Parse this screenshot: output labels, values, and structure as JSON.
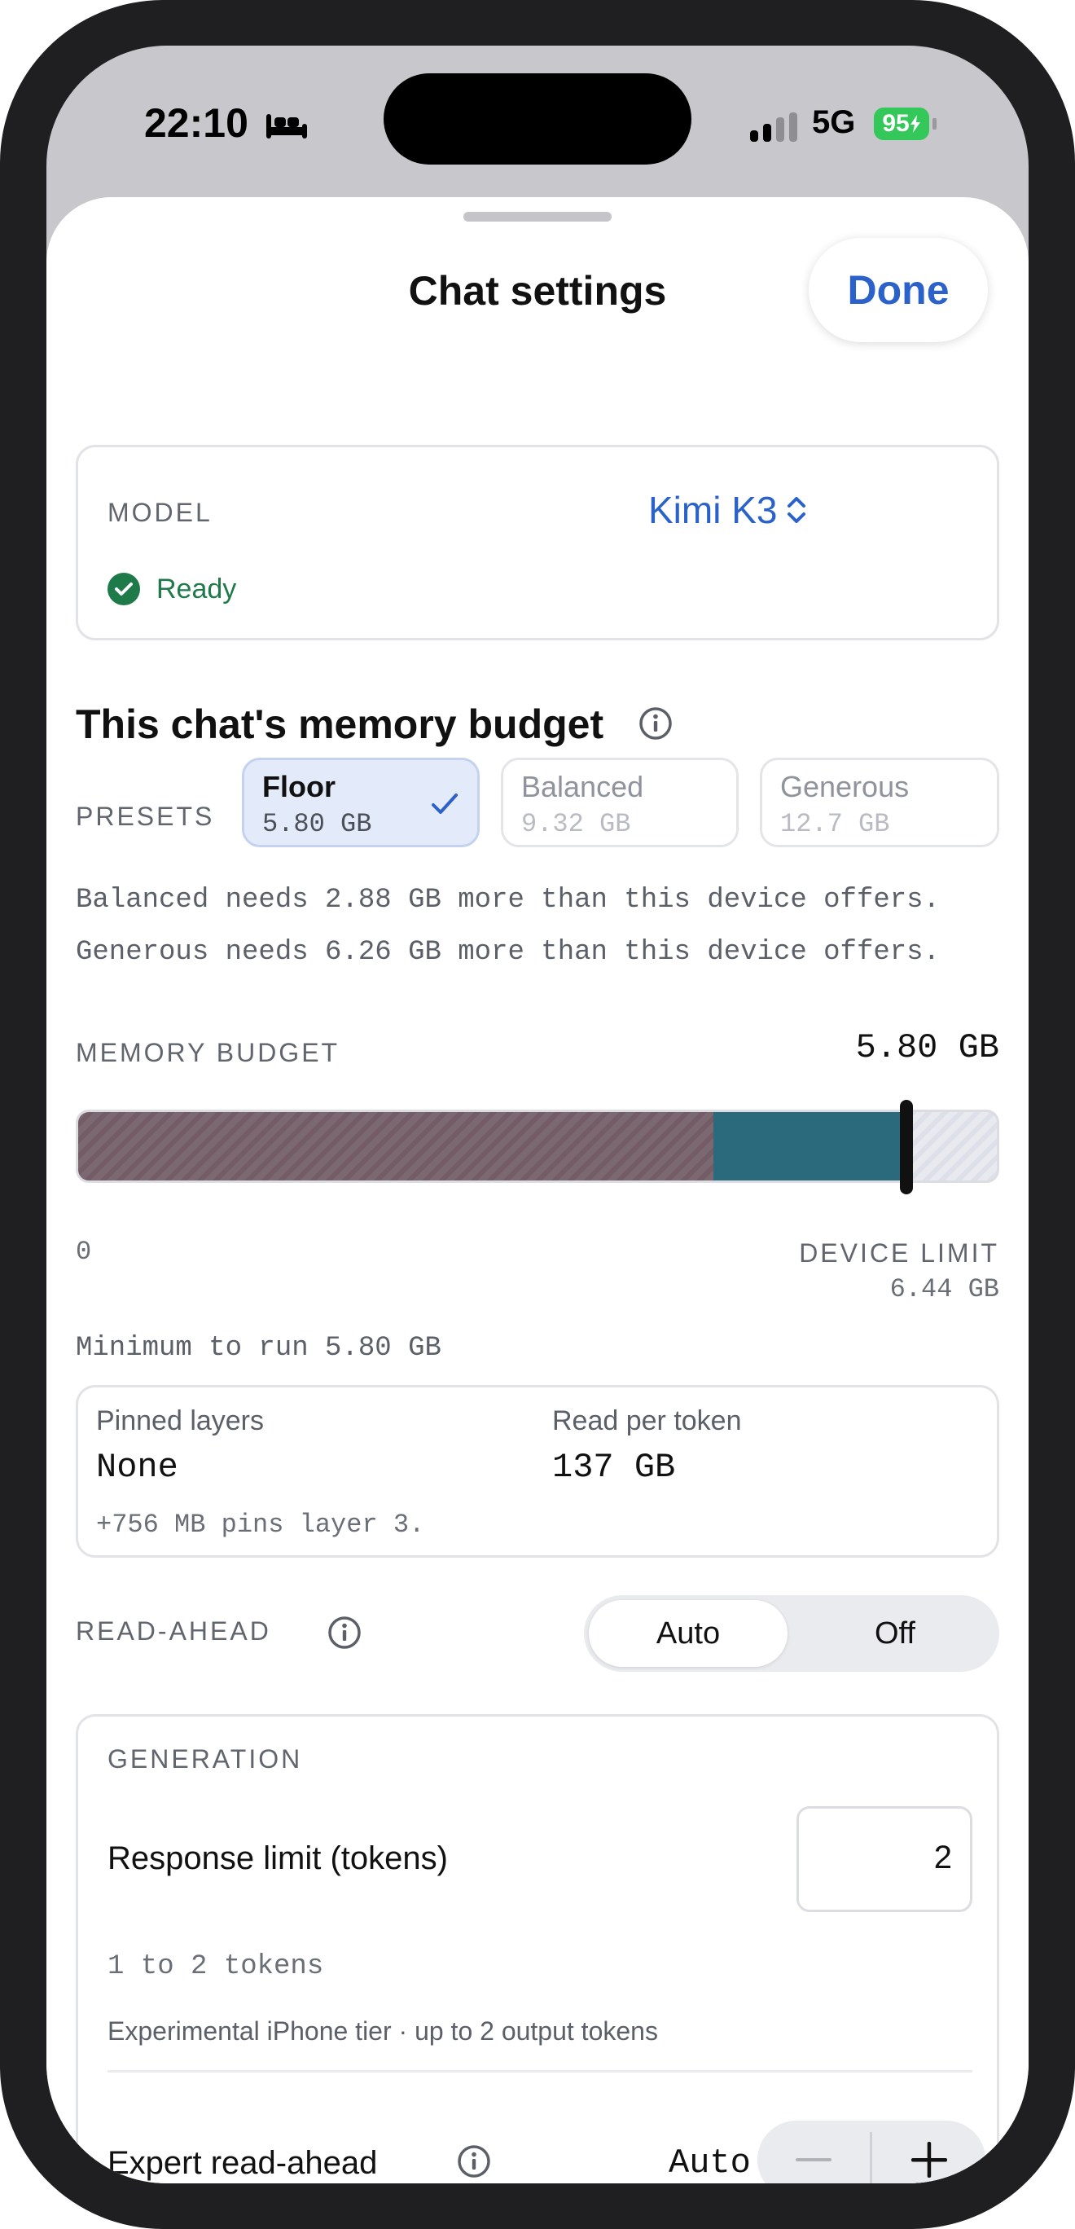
{
  "status_bar": {
    "time": "22:10",
    "network": "5G",
    "battery": "95"
  },
  "header": {
    "title": "Chat settings",
    "done_label": "Done"
  },
  "model": {
    "label": "MODEL",
    "selected": "Kimi K3",
    "status": "Ready"
  },
  "memory": {
    "heading": "This chat's memory budget",
    "presets_label": "PRESETS",
    "presets": [
      {
        "name": "Floor",
        "value": "5.80 GB",
        "selected": true
      },
      {
        "name": "Balanced",
        "value": "9.32 GB",
        "selected": false
      },
      {
        "name": "Generous",
        "value": "12.7 GB",
        "selected": false
      }
    ],
    "warnings": [
      "Balanced needs 2.88 GB more than this device offers.",
      "Generous needs 6.26 GB more than this device offers."
    ],
    "budget_label": "MEMORY BUDGET",
    "budget_value": "5.80 GB",
    "bar_min": "0",
    "device_limit_label": "DEVICE LIMIT",
    "device_limit_value": "6.44 GB",
    "minimum_text": "Minimum to run 5.80 GB",
    "budget_fraction": 0.9
  },
  "pin": {
    "pinned_label": "Pinned layers",
    "pinned_value": "None",
    "read_label": "Read per token",
    "read_value": "137 GB",
    "note": "+756 MB pins layer 3."
  },
  "read_ahead": {
    "label": "READ-AHEAD",
    "options": [
      "Auto",
      "Off"
    ],
    "selected": "Auto"
  },
  "generation": {
    "label": "GENERATION",
    "response_label": "Response limit (tokens)",
    "response_value": "2",
    "range": "1 to 2 tokens",
    "tier_note": "Experimental iPhone tier · up to 2 output tokens",
    "expert_label": "Expert read-ahead",
    "expert_value": "Auto"
  },
  "colors": {
    "accent": "#2a62c9",
    "ready_green": "#1f7a4a",
    "bar_teal": "#2b6a7d",
    "battery_green": "#34c759"
  }
}
